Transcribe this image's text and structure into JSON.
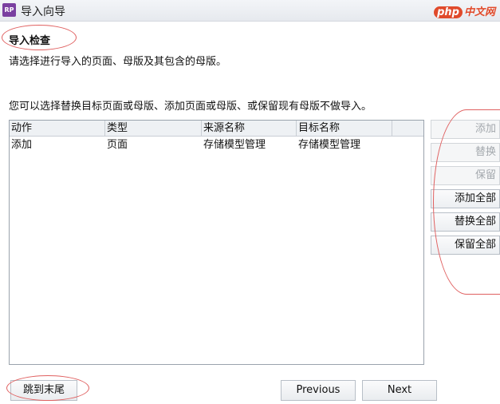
{
  "window": {
    "title": "导入向导",
    "app_icon_text": "RP",
    "watermark": {
      "php": "php",
      "rest": "中文网"
    }
  },
  "page": {
    "section_title": "导入检查",
    "description": "请选择进行导入的页面、母版及其包含的母版。",
    "instructions": "您可以选择替换目标页面或母版、添加页面或母版、或保留现有母版不做导入。"
  },
  "table": {
    "columns": [
      "动作",
      "类型",
      "来源名称",
      "目标名称"
    ],
    "rows": [
      [
        "添加",
        "页面",
        "存储模型管理",
        "存储模型管理"
      ]
    ]
  },
  "side_buttons": {
    "add": {
      "label": "添加",
      "enabled": false
    },
    "replace": {
      "label": "替换",
      "enabled": false
    },
    "keep": {
      "label": "保留",
      "enabled": false
    },
    "add_all": {
      "label": "添加全部",
      "enabled": true
    },
    "replace_all": {
      "label": "替换全部",
      "enabled": true
    },
    "keep_all": {
      "label": "保留全部",
      "enabled": true
    }
  },
  "footer": {
    "skip_to_end": "跳到末尾",
    "previous": "Previous",
    "next": "Next"
  },
  "colors": {
    "annotation_circle": "#e06060",
    "app_icon": "#7a3fa0",
    "disabled_text": "#a3a8ad"
  }
}
